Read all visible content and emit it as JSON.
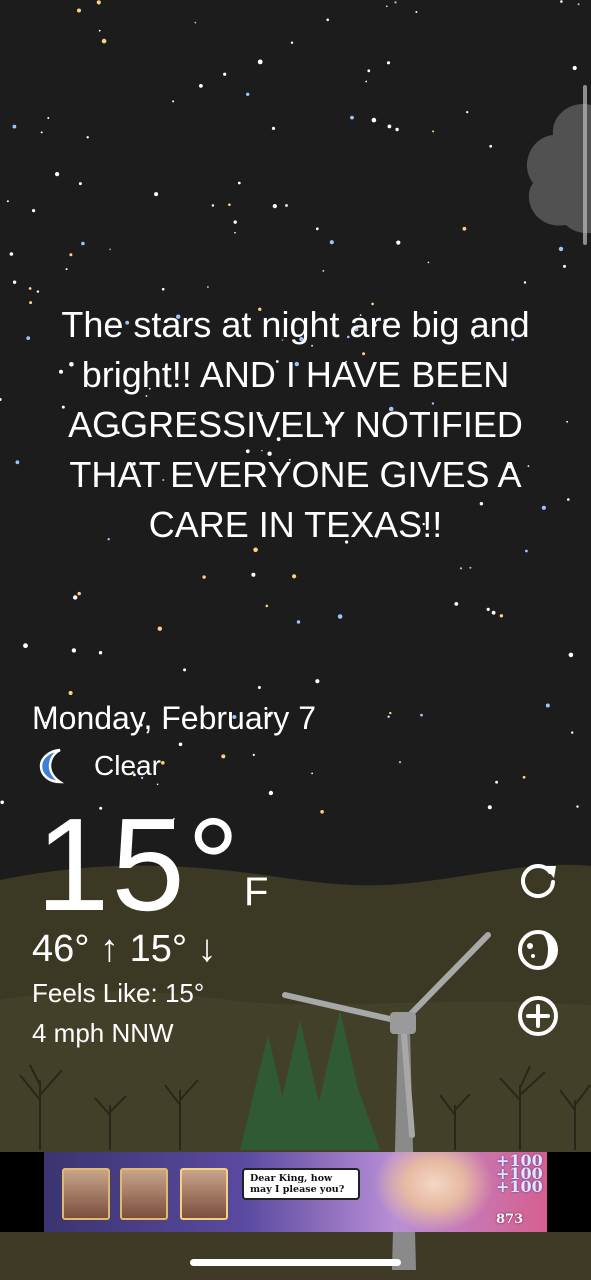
{
  "headline": "The stars at night are big and bright!! AND I HAVE BEEN AGGRESSIVELY NOTIFIED THAT EVERYONE GIVES A CARE IN TEXAS!!",
  "weather": {
    "date": "Monday, February 7",
    "condition": "Clear",
    "condition_icon": "moon-icon",
    "temperature": "15°",
    "unit": "F",
    "high_low": "46° ↑  15° ↓",
    "feels_like": "Feels Like: 15°",
    "wind": "4 mph NNW"
  },
  "controls": {
    "refresh_icon": "refresh-icon",
    "moon_phase_icon": "moon-phase-icon",
    "add_icon": "add-icon"
  },
  "ad": {
    "speech": "Dear King, how may I please you?",
    "bonus": "+100",
    "count": "873"
  },
  "colors": {
    "sky": "#1c1c1d",
    "ground": "#3e3a26",
    "moon": "#3f7dd8",
    "ad_border": "#e2b86b"
  }
}
